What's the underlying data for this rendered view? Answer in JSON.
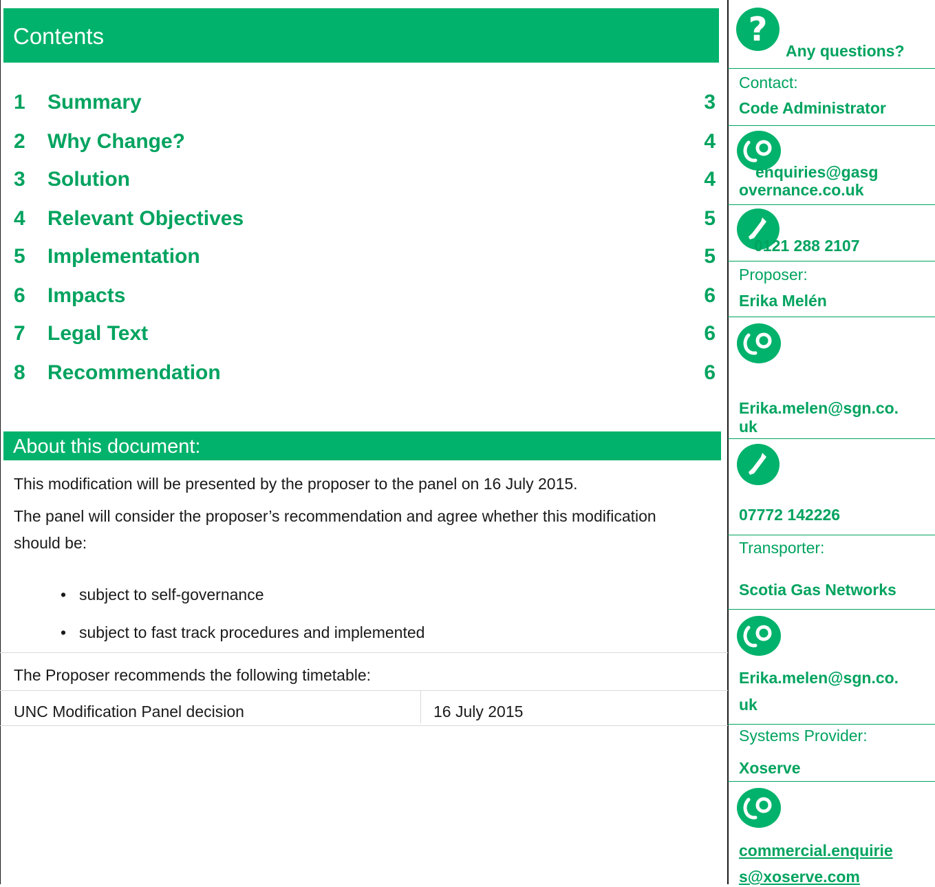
{
  "contents": {
    "title": "Contents",
    "items": [
      {
        "num": "1",
        "title": "Summary",
        "page": "3"
      },
      {
        "num": "2",
        "title": "Why Change?",
        "page": "4"
      },
      {
        "num": "3",
        "title": "Solution",
        "page": "4"
      },
      {
        "num": "4",
        "title": "Relevant Objectives",
        "page": "5"
      },
      {
        "num": "5",
        "title": "Implementation",
        "page": "5"
      },
      {
        "num": "6",
        "title": "Impacts",
        "page": "6"
      },
      {
        "num": "7",
        "title": "Legal Text",
        "page": "6"
      },
      {
        "num": "8",
        "title": "Recommendation",
        "page": "6"
      }
    ]
  },
  "about": {
    "title": "About this document:",
    "para1": "This modification will be presented by the proposer to the panel on 16 July 2015.",
    "para2": "The panel will consider the proposer’s recommendation and agree whether this modification should be:",
    "bullets": [
      "subject to self-governance",
      "subject to fast track procedures and implemented"
    ],
    "timetable_intro": "The Proposer recommends the following timetable:",
    "timetable": [
      {
        "event": "UNC Modification Panel decision",
        "date": "16 July 2015"
      }
    ]
  },
  "sidebar": {
    "questions": "Any questions?",
    "contact_label": "Contact:",
    "contact_name": "Code Administrator",
    "contact_email_1": "enquiries@gasg",
    "contact_email_2": "overnance.co.uk",
    "contact_phone": "0121 288 2107",
    "proposer_label": "Proposer:",
    "proposer_name": "Erika Melén",
    "proposer_email_1": "Erika.melen@sgn.co.",
    "proposer_email_2": "uk",
    "proposer_phone": "07772 142226",
    "transporter_label": "Transporter:",
    "transporter_name": "Scotia Gas Networks",
    "transporter_email_1": "Erika.melen@sgn.co.",
    "transporter_email_2": "uk",
    "systems_label": "Systems Provider:",
    "systems_name": "Xoserve",
    "systems_email_1": "commercial.enquirie",
    "systems_email_2": "s@xoserve.com"
  },
  "colors": {
    "accent": "#00b26b",
    "accent_text": "#00a35f"
  },
  "icons": [
    "question-icon",
    "email-icon",
    "phone-icon"
  ]
}
